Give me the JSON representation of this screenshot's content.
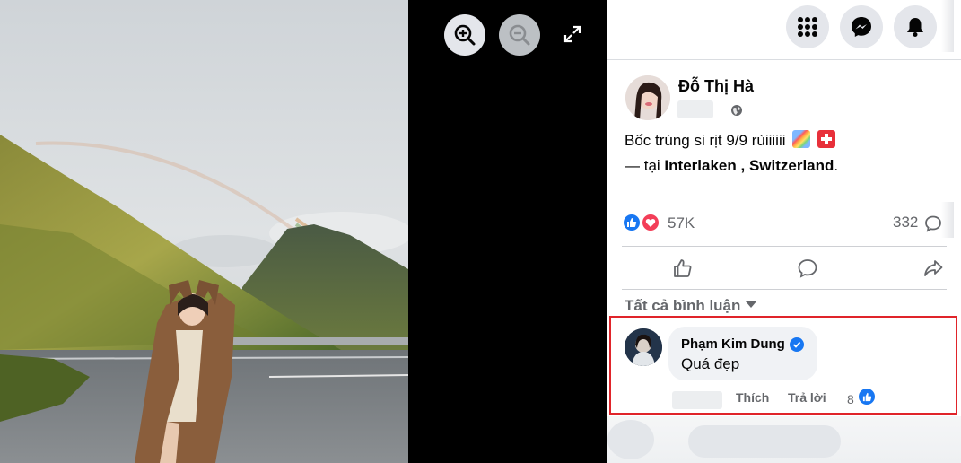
{
  "viewer": {
    "zoom_in_icon": "zoom-in-icon",
    "zoom_out_icon": "zoom-out-icon",
    "fullscreen_icon": "expand-icon"
  },
  "header": {
    "menu_icon": "grid-menu-icon",
    "messenger_icon": "messenger-icon",
    "notifications_icon": "bell-icon"
  },
  "post": {
    "author": "Đỗ Thị Hà",
    "text": "Bốc trúng si rịt 9/9 rùiiiiii",
    "emojis": [
      "rainbow",
      "swiss-flag"
    ],
    "location_prefix": "— tại",
    "location_city": "Interlaken",
    "location_sep": ",",
    "location_country": "Switzerland",
    "location_suffix": ".",
    "reaction_count": "57K",
    "comment_count": "332"
  },
  "comments": {
    "filter_label": "Tất cả bình luận",
    "items": [
      {
        "name": "Phạm Kim Dung",
        "verified": true,
        "text": "Quá đẹp",
        "like_label": "Thích",
        "reply_label": "Trả lời",
        "reaction_count": "8"
      }
    ]
  },
  "colors": {
    "facebook_blue": "#1877f2",
    "love_red": "#f33e58",
    "highlight_red": "#e0242a",
    "muted_text": "#65676b"
  }
}
